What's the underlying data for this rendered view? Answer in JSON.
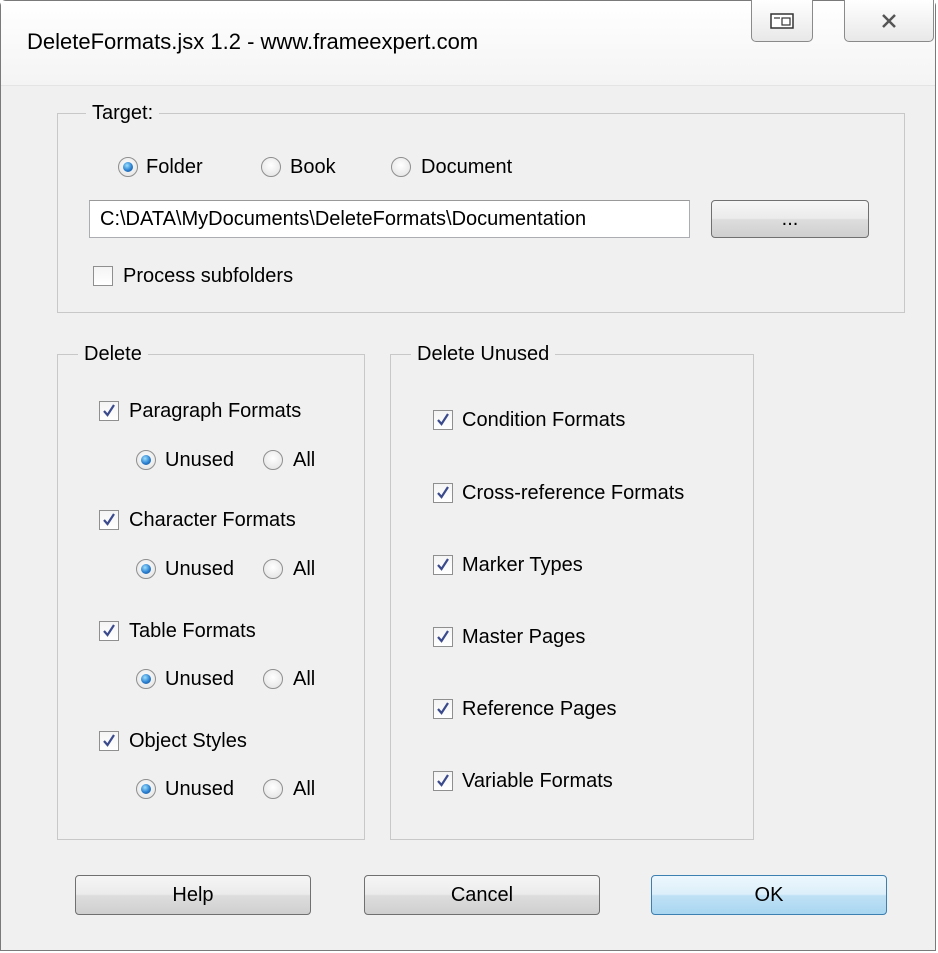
{
  "window": {
    "title": "DeleteFormats.jsx 1.2 - www.frameexpert.com"
  },
  "target": {
    "label": "Target:",
    "options": [
      "Folder",
      "Book",
      "Document"
    ],
    "selected": "Folder",
    "path": "C:\\DATA\\MyDocuments\\DeleteFormats\\Documentation",
    "browse_label": "...",
    "process_subfolders_label": "Process subfolders",
    "process_subfolders_checked": false
  },
  "delete": {
    "label": "Delete",
    "items": [
      {
        "label": "Paragraph Formats",
        "checked": true,
        "unused_label": "Unused",
        "all_label": "All",
        "selected": "Unused"
      },
      {
        "label": "Character Formats",
        "checked": true,
        "unused_label": "Unused",
        "all_label": "All",
        "selected": "Unused"
      },
      {
        "label": "Table Formats",
        "checked": true,
        "unused_label": "Unused",
        "all_label": "All",
        "selected": "Unused"
      },
      {
        "label": "Object Styles",
        "checked": true,
        "unused_label": "Unused",
        "all_label": "All",
        "selected": "Unused"
      }
    ]
  },
  "delete_unused": {
    "label": "Delete Unused",
    "items": [
      {
        "label": "Condition Formats",
        "checked": true
      },
      {
        "label": "Cross-reference Formats",
        "checked": true
      },
      {
        "label": "Marker Types",
        "checked": true
      },
      {
        "label": "Master Pages",
        "checked": true
      },
      {
        "label": "Reference Pages",
        "checked": true
      },
      {
        "label": "Variable Formats",
        "checked": true
      }
    ]
  },
  "footer": {
    "help_label": "Help",
    "cancel_label": "Cancel",
    "ok_label": "OK"
  },
  "icons": {
    "restore": "restore-window-icon",
    "close": "close-icon",
    "check": "checkmark-icon"
  },
  "colors": {
    "radio_selected": "#2a7fd0",
    "check_mark": "#3a4a8c",
    "ok_button": "#a9d6f1"
  }
}
